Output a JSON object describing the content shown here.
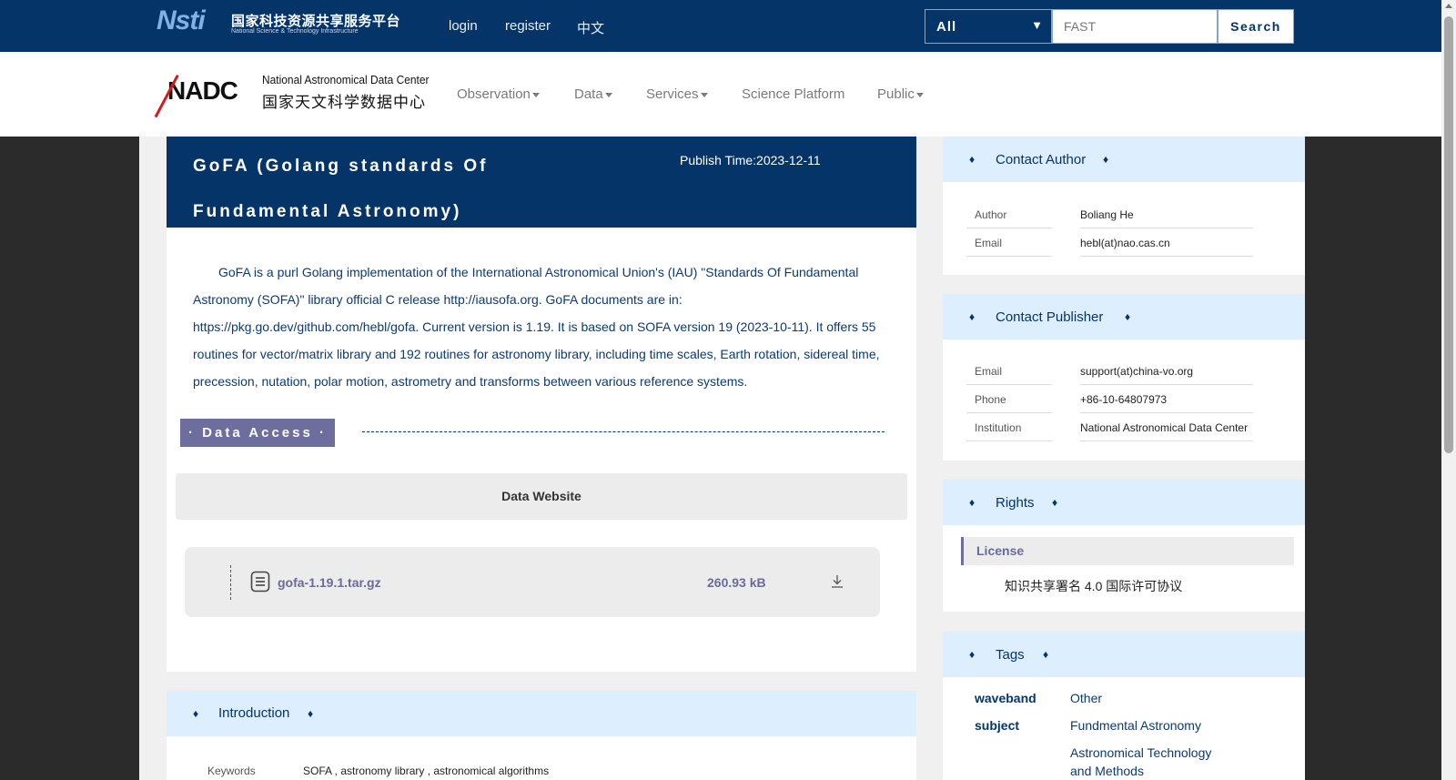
{
  "topbar": {
    "logo_mark": "Nsti",
    "logo_cn": "国家科技资源共享服务平台",
    "logo_en": "National Science & Technology Infrastructure",
    "login": "login",
    "register": "register",
    "lang": "中文",
    "search_scope": "All",
    "search_value": "FAST",
    "search_button": "Search"
  },
  "nav": {
    "logo_mark": "NADC",
    "logo_en": "National Astronomical Data Center",
    "logo_cn": "国家天文科学数据中心",
    "items": [
      "Observation",
      "Data",
      "Services",
      "Science Platform",
      "Public"
    ]
  },
  "main": {
    "title": "GoFA (Golang standards Of Fundamental Astronomy)",
    "publish_time": "Publish Time:2023-12-11",
    "description": "GoFA is a purl Golang implementation of the International Astronomical Union's (IAU) \"Standards Of Fundamental Astronomy (SOFA)\" library official C release http://iausofa.org. GoFA documents are in: https://pkg.go.dev/github.com/hebl/gofa. Current version is 1.19. It is based on SOFA version 19 (2023-10-11). It offers 55 routines for vector/matrix library and 192 routines for astronomy library, including time scales, Earth rotation, sidereal time, precession, nutation, polar motion, astrometry and transforms between various reference systems.",
    "data_access_label": "· Data Access ·",
    "data_website": "Data Website",
    "file": {
      "name": "gofa-1.19.1.tar.gz",
      "size": "260.93 kB"
    },
    "introduction": {
      "title": "Introduction",
      "keywords_label": "Keywords",
      "keywords_value": "SOFA , astronomy library , astronomical algorithms"
    }
  },
  "sidebar": {
    "contact_author": {
      "title": "Contact Author",
      "author_label": "Author",
      "author_value": "Boliang He",
      "email_label": "Email",
      "email_value": "hebl(at)nao.cas.cn"
    },
    "contact_publisher": {
      "title": "Contact Publisher",
      "email_label": "Email",
      "email_value": "support(at)china-vo.org",
      "phone_label": "Phone",
      "phone_value": "+86-10-64807973",
      "institution_label": "Institution",
      "institution_value": "National Astronomical Data Center"
    },
    "rights": {
      "title": "Rights",
      "license_label": "License",
      "license_value": "知识共享署名 4.0 国际许可协议"
    },
    "tags": {
      "title": "Tags",
      "waveband_label": "waveband",
      "waveband_value": "Other",
      "subject_label": "subject",
      "subject_values": [
        "Fundmental Astronomy",
        "Astronomical Technology and Methods"
      ]
    }
  },
  "glyphs": {
    "diamond": "♦"
  }
}
